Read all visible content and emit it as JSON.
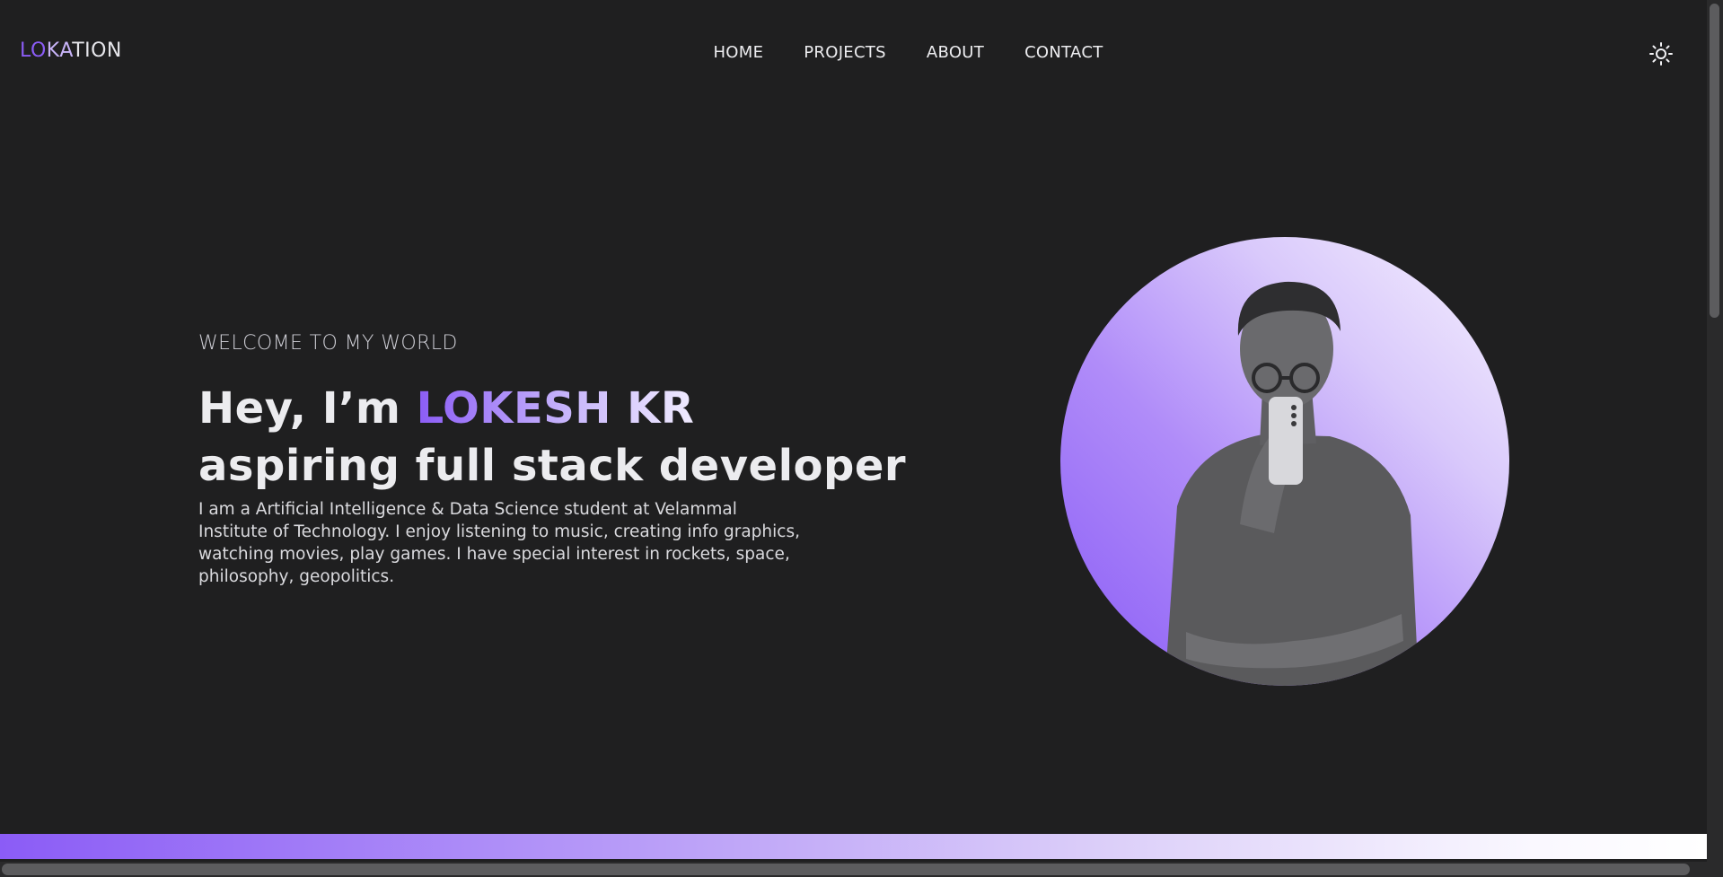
{
  "brand": {
    "logo_part1": "LO",
    "logo_part2": "KA",
    "logo_part3": "TION"
  },
  "nav": {
    "items": [
      "HOME",
      "PROJECTS",
      "ABOUT",
      "CONTACT"
    ]
  },
  "toolbar": {
    "theme_icon": "sun-icon"
  },
  "hero": {
    "welcome": "WELCOME TO MY WORLD",
    "greeting": "Hey, I’m ",
    "name": "LOKESH KR",
    "role": "aspiring full stack developer",
    "bio": "I am a Artificial Intelligence & Data Science student at Velammal Institute of Technology. I enjoy listening to music, creating info graphics, watching movies, play games. I have special interest in rockets, space, philosophy, geopolitics."
  },
  "colors": {
    "accent": "#8b5cf6",
    "background": "#1f1f20",
    "text": "#ececef"
  }
}
